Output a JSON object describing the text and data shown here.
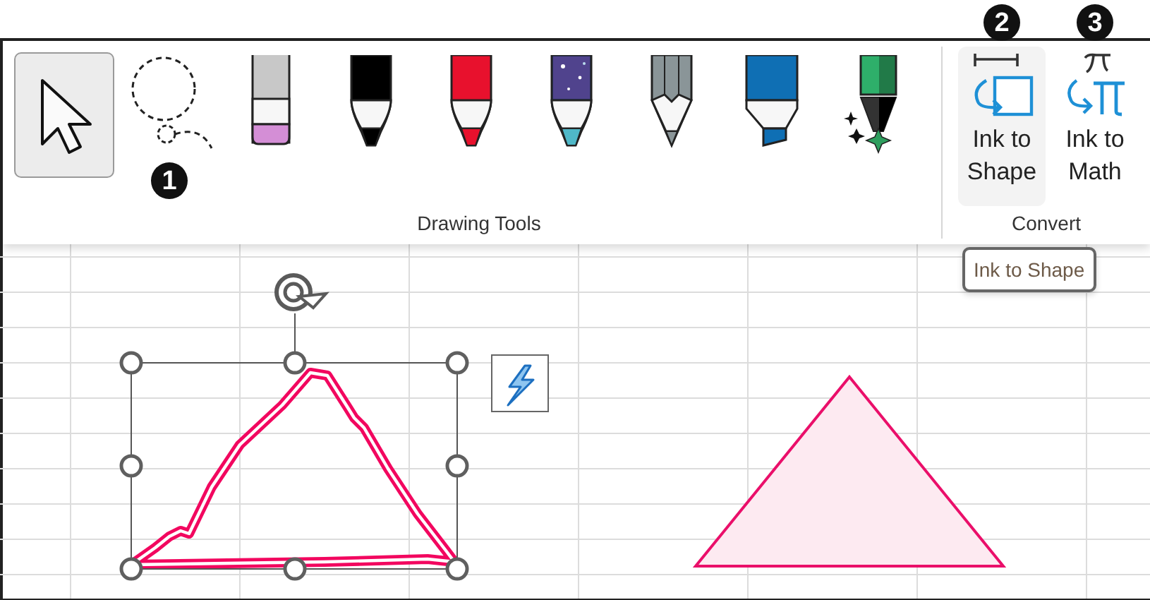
{
  "ribbon": {
    "groups": [
      {
        "label": "Drawing Tools",
        "tools": [
          {
            "kind": "select",
            "selected": true
          },
          {
            "kind": "lasso",
            "selected": false,
            "badge": "1"
          },
          {
            "kind": "eraser",
            "selected": false
          },
          {
            "kind": "pen",
            "selected": false,
            "color": "#000000"
          },
          {
            "kind": "pen",
            "selected": false,
            "color": "#e8112d"
          },
          {
            "kind": "galaxy",
            "selected": false
          },
          {
            "kind": "pencil",
            "selected": false
          },
          {
            "kind": "highlighter",
            "selected": false
          },
          {
            "kind": "action",
            "selected": false
          }
        ]
      },
      {
        "label": "Convert",
        "buttons": [
          {
            "kind": "shape",
            "line1": "Ink to",
            "line2": "Shape",
            "selected": true,
            "badge": "2"
          },
          {
            "kind": "math",
            "line1": "Ink to",
            "line2": "Math",
            "selected": false,
            "badge": "3"
          }
        ]
      }
    ]
  },
  "tooltip": "Ink to Shape",
  "canvas": {
    "ink_drawing": {
      "selected": true
    },
    "shape": {
      "kind": "triangle"
    }
  }
}
